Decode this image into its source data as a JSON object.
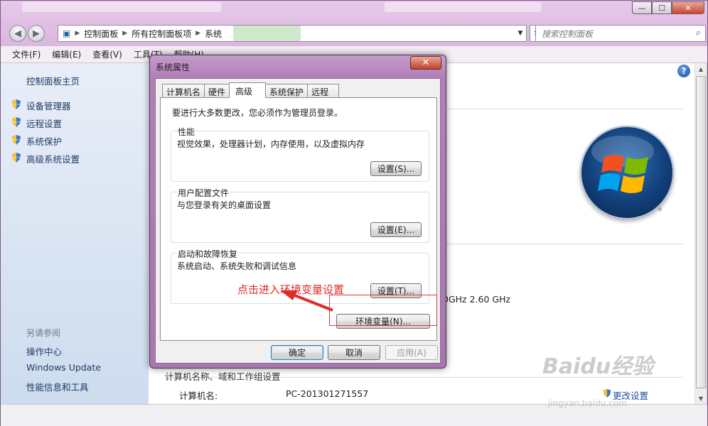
{
  "window": {
    "controls": {
      "minimize": "—",
      "maximize": "☐",
      "close": "✕"
    }
  },
  "nav": {
    "back_icon": "◀",
    "forward_icon": "▶",
    "breadcrumbs": [
      "控制面板",
      "所有控制面板项",
      "系统"
    ],
    "search_placeholder": "搜索控制面板"
  },
  "menubar": {
    "items": [
      "文件(F)",
      "编辑(E)",
      "查看(V)",
      "工具(T)",
      "帮助(H)"
    ]
  },
  "sidebar": {
    "home": "控制面板主页",
    "tasks": [
      "设备管理器",
      "远程设置",
      "系统保护",
      "高级系统设置"
    ],
    "see_also_heading": "另请参阅",
    "see_also": [
      "操作中心",
      "Windows Update",
      "性能信息和工具"
    ]
  },
  "main": {
    "cpu_speed": "0GHz   2.60 GHz",
    "section_computer": "计算机名称、域和工作组设置",
    "computer_name_label": "计算机名:",
    "computer_name_value": "PC-201301271557",
    "change_settings": "更改设置"
  },
  "dialog": {
    "title": "系统属性",
    "tabs": [
      "计算机名",
      "硬件",
      "高级",
      "系统保护",
      "远程"
    ],
    "active_tab": "高级",
    "admin_note": "要进行大多数更改，您必须作为管理员登录。",
    "performance": {
      "label": "性能",
      "desc": "视觉效果，处理器计划，内存使用，以及虚拟内存",
      "button": "设置(S)..."
    },
    "profile": {
      "label": "用户配置文件",
      "desc": "与您登录有关的桌面设置",
      "button": "设置(E)..."
    },
    "startup": {
      "label": "启动和故障恢复",
      "desc": "系统启动、系统失败和调试信息",
      "button": "设置(T)..."
    },
    "env_button": "环境变量(N)...",
    "ok": "确定",
    "cancel": "取消",
    "apply": "应用(A)"
  },
  "annotation": {
    "text": "点击进入环境变量设置",
    "color": "#e02a2a"
  },
  "watermark": {
    "brand": "Baidu经验",
    "url": "jingyan.baidu.com"
  }
}
